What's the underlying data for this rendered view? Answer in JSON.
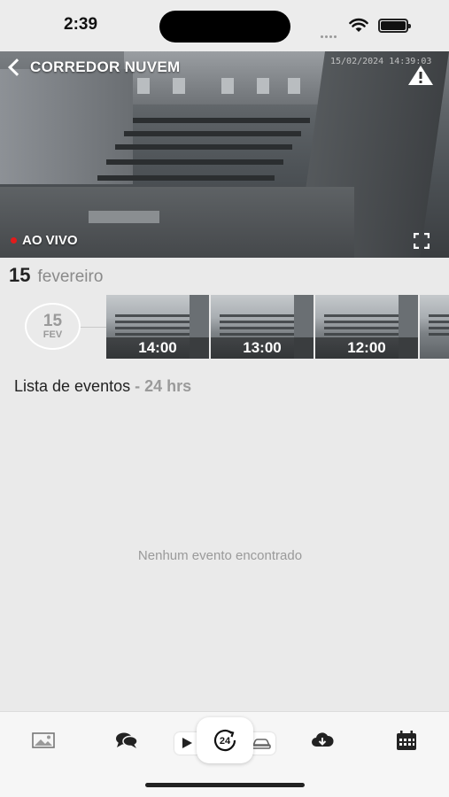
{
  "status_bar": {
    "time": "2:39"
  },
  "camera": {
    "title": "CORREDOR NUVEM",
    "timestamp": "15/02/2024  14:39:03",
    "live_label": "AO VIVO"
  },
  "date": {
    "day": "15",
    "month": "fevereiro"
  },
  "timeline": {
    "day_badge": {
      "day": "15",
      "month": "FEV"
    },
    "thumbnails": [
      {
        "label": "14:00"
      },
      {
        "label": "13:00"
      },
      {
        "label": "12:00"
      },
      {
        "label": ""
      }
    ]
  },
  "events": {
    "title": "Lista de eventos",
    "range": "- 24 hrs",
    "empty_message": "Nenhum evento encontrado"
  },
  "bottom_bar": {
    "items": [
      "gallery-icon",
      "chat-icon",
      "play-icon",
      "24h-history-icon",
      "car-icon",
      "cloud-download-icon",
      "calendar-icon"
    ]
  }
}
